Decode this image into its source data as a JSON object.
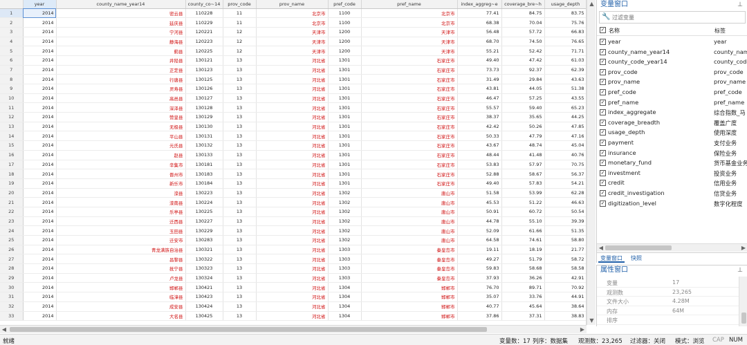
{
  "grid": {
    "columns": [
      {
        "name": "year",
        "type": "num"
      },
      {
        "name": "county_name_year14",
        "type": "str"
      },
      {
        "name": "county_co~14",
        "type": "ctr"
      },
      {
        "name": "prov_code",
        "type": "ctr"
      },
      {
        "name": "prov_name",
        "type": "str"
      },
      {
        "name": "pref_code",
        "type": "ctr"
      },
      {
        "name": "pref_name",
        "type": "str"
      },
      {
        "name": "index_aggreg~e",
        "type": "num"
      },
      {
        "name": "coverage_bre~h",
        "type": "num"
      },
      {
        "name": "usage_depth",
        "type": "num"
      }
    ],
    "rows": [
      [
        "2014",
        "密云县",
        "110228",
        "11",
        "北京市",
        "1100",
        "北京市",
        "77.41",
        "84.75",
        "83.75"
      ],
      [
        "2014",
        "延庆县",
        "110229",
        "11",
        "北京市",
        "1100",
        "北京市",
        "68.38",
        "70.04",
        "75.76"
      ],
      [
        "2014",
        "宁河县",
        "120221",
        "12",
        "天津市",
        "1200",
        "天津市",
        "56.48",
        "57.72",
        "66.83"
      ],
      [
        "2014",
        "静海县",
        "120223",
        "12",
        "天津市",
        "1200",
        "天津市",
        "68.70",
        "74.50",
        "76.65"
      ],
      [
        "2014",
        "蓟县",
        "120225",
        "12",
        "天津市",
        "1200",
        "天津市",
        "55.21",
        "52.42",
        "71.71"
      ],
      [
        "2014",
        "井陉县",
        "130121",
        "13",
        "河北省",
        "1301",
        "石家庄市",
        "49.40",
        "47.42",
        "61.03"
      ],
      [
        "2014",
        "正定县",
        "130123",
        "13",
        "河北省",
        "1301",
        "石家庄市",
        "73.73",
        "92.37",
        "62.39"
      ],
      [
        "2014",
        "行唐县",
        "130125",
        "13",
        "河北省",
        "1301",
        "石家庄市",
        "31.49",
        "29.84",
        "43.63"
      ],
      [
        "2014",
        "灵寿县",
        "130126",
        "13",
        "河北省",
        "1301",
        "石家庄市",
        "43.81",
        "44.05",
        "51.38"
      ],
      [
        "2014",
        "高邑县",
        "130127",
        "13",
        "河北省",
        "1301",
        "石家庄市",
        "46.47",
        "57.25",
        "43.55"
      ],
      [
        "2014",
        "深泽县",
        "130128",
        "13",
        "河北省",
        "1301",
        "石家庄市",
        "55.57",
        "59.40",
        "65.23"
      ],
      [
        "2014",
        "赞皇县",
        "130129",
        "13",
        "河北省",
        "1301",
        "石家庄市",
        "38.37",
        "35.65",
        "44.25"
      ],
      [
        "2014",
        "无极县",
        "130130",
        "13",
        "河北省",
        "1301",
        "石家庄市",
        "42.42",
        "50.26",
        "47.85"
      ],
      [
        "2014",
        "平山县",
        "130131",
        "13",
        "河北省",
        "1301",
        "石家庄市",
        "50.33",
        "47.79",
        "47.16"
      ],
      [
        "2014",
        "元氏县",
        "130132",
        "13",
        "河北省",
        "1301",
        "石家庄市",
        "43.67",
        "48.74",
        "45.04"
      ],
      [
        "2014",
        "赵县",
        "130133",
        "13",
        "河北省",
        "1301",
        "石家庄市",
        "48.44",
        "41.48",
        "40.76"
      ],
      [
        "2014",
        "辛集市",
        "130181",
        "13",
        "河北省",
        "1301",
        "石家庄市",
        "53.83",
        "57.97",
        "70.75"
      ],
      [
        "2014",
        "晋州市",
        "130183",
        "13",
        "河北省",
        "1301",
        "石家庄市",
        "52.88",
        "58.67",
        "56.37"
      ],
      [
        "2014",
        "新乐市",
        "130184",
        "13",
        "河北省",
        "1301",
        "石家庄市",
        "49.40",
        "57.83",
        "54.21"
      ],
      [
        "2014",
        "滦县",
        "130223",
        "13",
        "河北省",
        "1302",
        "唐山市",
        "51.58",
        "53.99",
        "62.28"
      ],
      [
        "2014",
        "滦南县",
        "130224",
        "13",
        "河北省",
        "1302",
        "唐山市",
        "45.53",
        "51.22",
        "46.63"
      ],
      [
        "2014",
        "乐亭县",
        "130225",
        "13",
        "河北省",
        "1302",
        "唐山市",
        "50.91",
        "60.72",
        "50.54"
      ],
      [
        "2014",
        "迁西县",
        "130227",
        "13",
        "河北省",
        "1302",
        "唐山市",
        "44.78",
        "55.10",
        "39.39"
      ],
      [
        "2014",
        "玉田县",
        "130229",
        "13",
        "河北省",
        "1302",
        "唐山市",
        "52.09",
        "61.66",
        "51.35"
      ],
      [
        "2014",
        "迁安市",
        "130283",
        "13",
        "河北省",
        "1302",
        "唐山市",
        "64.58",
        "74.61",
        "58.80"
      ],
      [
        "2014",
        "青龙满族自治县",
        "130321",
        "13",
        "河北省",
        "1303",
        "秦皇岛市",
        "19.11",
        "18.19",
        "21.77"
      ],
      [
        "2014",
        "昌黎县",
        "130322",
        "13",
        "河北省",
        "1303",
        "秦皇岛市",
        "49.27",
        "51.79",
        "58.72"
      ],
      [
        "2014",
        "抚宁县",
        "130323",
        "13",
        "河北省",
        "1303",
        "秦皇岛市",
        "59.83",
        "58.68",
        "58.58"
      ],
      [
        "2014",
        "卢龙县",
        "130324",
        "13",
        "河北省",
        "1303",
        "秦皇岛市",
        "37.93",
        "36.26",
        "42.91"
      ],
      [
        "2014",
        "邯郸县",
        "130421",
        "13",
        "河北省",
        "1304",
        "邯郸市",
        "76.70",
        "89.71",
        "70.92"
      ],
      [
        "2014",
        "临漳县",
        "130423",
        "13",
        "河北省",
        "1304",
        "邯郸市",
        "35.07",
        "33.76",
        "44.91"
      ],
      [
        "2014",
        "成安县",
        "130424",
        "13",
        "河北省",
        "1304",
        "邯郸市",
        "40.77",
        "45.64",
        "38.64"
      ],
      [
        "2014",
        "大名县",
        "130425",
        "13",
        "河北省",
        "1304",
        "邯郸市",
        "37.86",
        "37.31",
        "38.83"
      ]
    ]
  },
  "variables_panel": {
    "title": "变量窗口",
    "filter_placeholder": "过滤变量",
    "col_name": "名称",
    "col_label": "标签",
    "vars": [
      {
        "name": "year",
        "label": "year"
      },
      {
        "name": "county_name_year14",
        "label": "county_nam"
      },
      {
        "name": "county_code_year14",
        "label": "county_code"
      },
      {
        "name": "prov_code",
        "label": "prov_code"
      },
      {
        "name": "prov_name",
        "label": "prov_name"
      },
      {
        "name": "pref_code",
        "label": "pref_code"
      },
      {
        "name": "pref_name",
        "label": "pref_name"
      },
      {
        "name": "index_aggregate",
        "label": "综合指数_马"
      },
      {
        "name": "coverage_breadth",
        "label": "覆盖广度"
      },
      {
        "name": "usage_depth",
        "label": "使用深度"
      },
      {
        "name": "payment",
        "label": "支付业务"
      },
      {
        "name": "insurance",
        "label": "保险业务"
      },
      {
        "name": "monetary_fund",
        "label": "货币基金业务"
      },
      {
        "name": "investment",
        "label": "投资业务"
      },
      {
        "name": "credit",
        "label": "信用业务"
      },
      {
        "name": "credit_investigation",
        "label": "信贷业务"
      },
      {
        "name": "digitization_level",
        "label": "数字化程度"
      }
    ],
    "tabs": [
      "变量窗口",
      "快照"
    ]
  },
  "properties_panel": {
    "title": "属性窗口",
    "rows": [
      {
        "key": "变量",
        "value": "17"
      },
      {
        "key": "观测数",
        "value": "23,265"
      },
      {
        "key": "文件大小",
        "value": "4.28M"
      },
      {
        "key": "内存",
        "value": "64M"
      },
      {
        "key": "排序",
        "value": ""
      }
    ]
  },
  "statusbar": {
    "ready": "就绪",
    "vars": "变量数：17",
    "order": "列序：数据集",
    "obs": "观测数：23,265",
    "filter": "过滤器：关闭",
    "mode": "模式：浏览",
    "cap": "CAP",
    "num": "NUM"
  },
  "colors": {
    "accent": "#1f5fa8",
    "string_text": "#d01010"
  }
}
